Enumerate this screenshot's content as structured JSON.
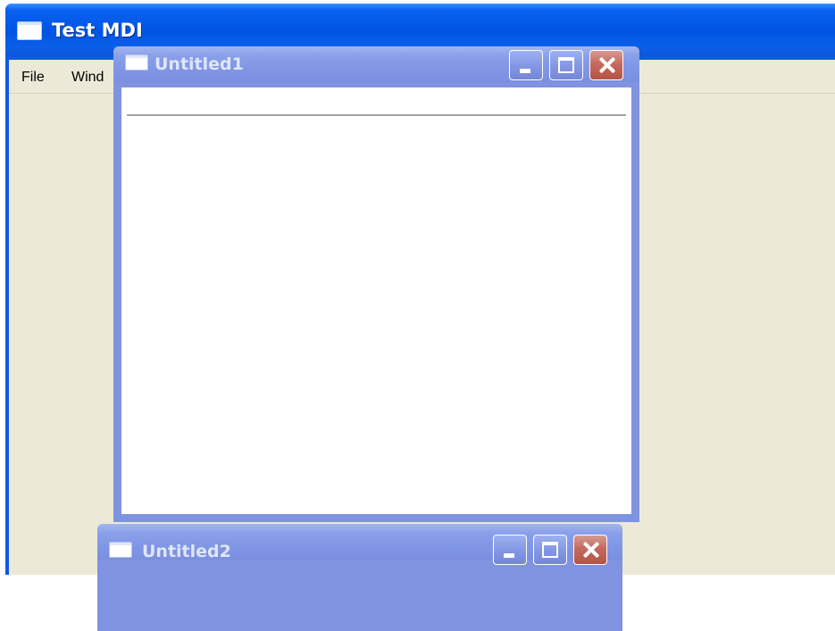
{
  "main_window": {
    "title": "Test MDI",
    "menu": [
      {
        "label": "File"
      },
      {
        "label": "Wind"
      }
    ]
  },
  "child_windows": [
    {
      "title": "Untitled1",
      "state": "inactive"
    },
    {
      "title": "Untitled2",
      "state": "inactive"
    }
  ],
  "colors": {
    "titlebar_active": "#0054e3",
    "titlebar_inactive": "#7f94e4",
    "client_background": "#ece9d8",
    "close_button": "#c56a5f"
  },
  "icons": {
    "app": "window-icon",
    "minimize": "minimize-icon",
    "maximize": "maximize-icon",
    "close": "close-icon"
  }
}
